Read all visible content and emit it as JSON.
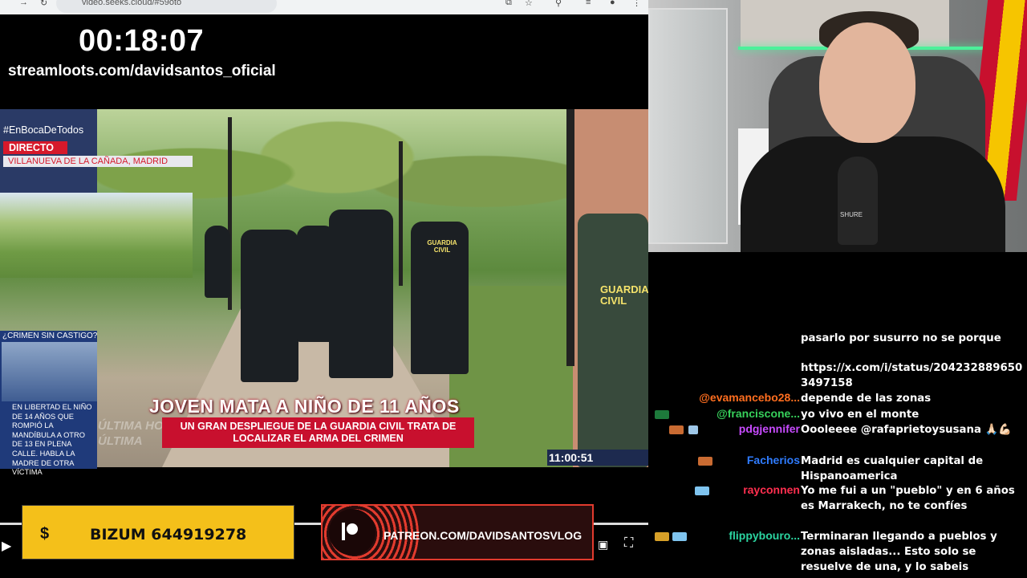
{
  "browser": {
    "url": "video.seeks.cloud/#59oto"
  },
  "stream": {
    "timer": "00:18:07",
    "streamloots_url": "streamloots.com/davidsantos_oficial"
  },
  "news": {
    "hashtag": "#EnBocaDeTodos",
    "live_label": "DIRECTO",
    "location": "VILLANUEVA DE LA CAÑADA, MADRID",
    "side_title": "¿CRIMEN SIN CASTIGO?",
    "side_text": "EN LIBERTAD EL NIÑO DE 14 AÑOS QUE ROMPIÓ LA MANDÍBULA A OTRO DE 13 EN PLENA CALLE. HABLA LA MADRE DE OTRA VÍCTIMA",
    "ultima_top": "ÚLTIMA HORA",
    "ultima_bottom": "ÚLTIMA",
    "headline": "JOVEN MATA A NIÑO DE 11 AÑOS",
    "subheadline_1": "UN GRAN DESPLIEGUE DE LA GUARDIA CIVIL TRATA DE",
    "subheadline_2": "LOCALIZAR EL ARMA DEL CRIMEN",
    "time": "11:00:51",
    "uniform_text_1": "GUARDIA CIVIL",
    "uniform_text_2": "GUARDIA CIVIL"
  },
  "banners": {
    "bizum_symbol": "$",
    "bizum_text": "BIZUM 644919278",
    "patreon_text": "PATREON.COM/DAVIDSANTOSVLOG"
  },
  "webcam": {
    "mic_brand": "SHURE"
  },
  "chat": {
    "messages": [
      {
        "user": "",
        "text": "pasarlo por susurro no se porque",
        "color": "#ffffff"
      },
      {
        "user": "",
        "text": "https://x.com/i/status/2042328896503497158",
        "color": "#ffffff"
      },
      {
        "user": "@evamancebo28...",
        "text": "depende de las zonas",
        "color": "#ff6e1f"
      },
      {
        "user": "@franciscone...",
        "text": "yo vivo en el monte",
        "color": "#37d05b"
      },
      {
        "user": "pdgjennifer",
        "text": "Oooleeee @rafaprietoysusana 🙏🏻💪🏻",
        "color": "#c84bff"
      },
      {
        "user": "Facherios",
        "text": "Madrid es cualquier capital de Hispanoamerica",
        "color": "#2f7cff"
      },
      {
        "user": "rayconnen",
        "text": "Yo me fui a un \"pueblo\" y en 6 años es Marrakech, no te confíes",
        "color": "#ff2f4f"
      },
      {
        "user": "flippybouro...",
        "text": "Terminaran llegando a pueblos y zonas aisladas... Esto solo se resuelve de una, y lo sabeis",
        "color": "#2bd4a0"
      }
    ]
  }
}
